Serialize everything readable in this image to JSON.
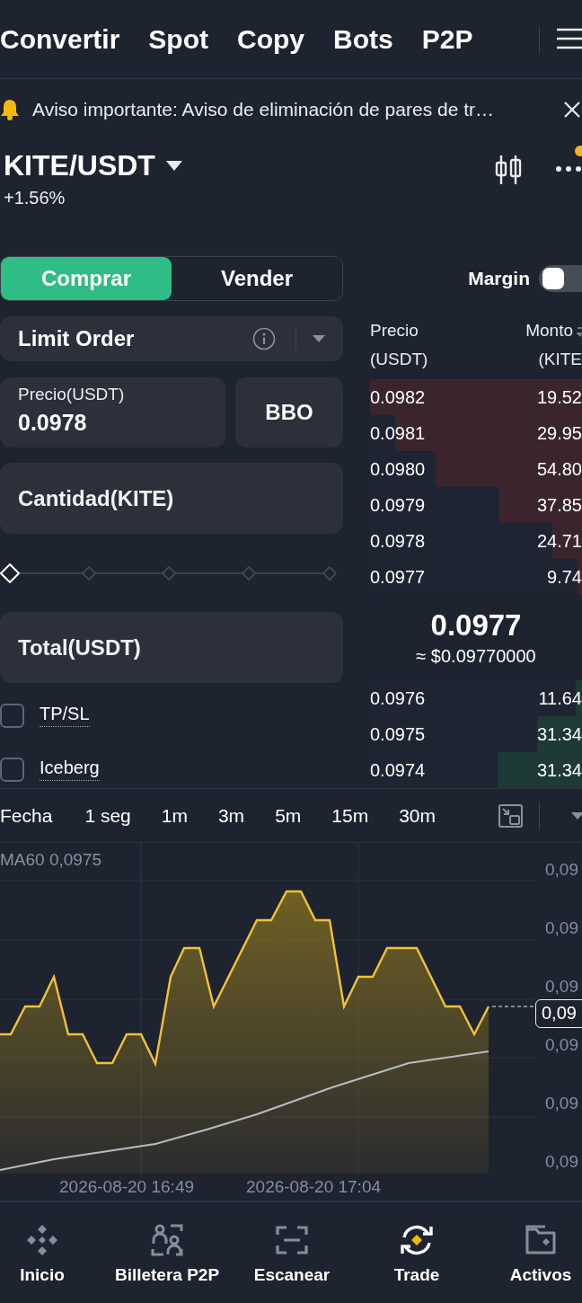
{
  "top_tabs": [
    {
      "label": "Convertir"
    },
    {
      "label": "Spot"
    },
    {
      "label": "Copy"
    },
    {
      "label": "Bots"
    },
    {
      "label": "P2P"
    }
  ],
  "notice": {
    "text": "Aviso importante: Aviso de eliminación de pares de tr…"
  },
  "pair": {
    "symbol": "KITE/USDT",
    "change": "+1.56%"
  },
  "order_form": {
    "sides": [
      {
        "label": "Comprar",
        "selected": true
      },
      {
        "label": "Vender",
        "selected": false
      }
    ],
    "margin": {
      "label": "Margin",
      "on": false
    },
    "order_type": "Limit Order",
    "price": {
      "label": "Precio(USDT)",
      "value": "0.0978"
    },
    "bbo": "BBO",
    "quantity": {
      "placeholder": "Cantidad(KITE)"
    },
    "slider": {
      "level": 0
    },
    "total": {
      "placeholder": "Total(USDT)"
    },
    "options": [
      {
        "label": "TP/SL",
        "checked": false
      },
      {
        "label": "Iceberg",
        "checked": false
      }
    ]
  },
  "order_book": {
    "price_header": "Precio (USDT)",
    "amount_header": "Monto",
    "amount_unit": "(KITE",
    "asks": [
      {
        "price": "0.0982",
        "amount": "19.52",
        "level": 1.0
      },
      {
        "price": "0.0981",
        "amount": "29.95",
        "level": 0.88
      },
      {
        "price": "0.0980",
        "amount": "54.80",
        "level": 0.69
      },
      {
        "price": "0.0979",
        "amount": "37.85",
        "level": 0.39
      },
      {
        "price": "0.0978",
        "amount": "24.71",
        "level": 0.14
      },
      {
        "price": "0.0977",
        "amount": "9.74",
        "level": 0.02
      }
    ],
    "mid_price": "0.0977",
    "mid_usd": "≈ $0.09770000",
    "bids": [
      {
        "price": "0.0976",
        "amount": "11.64",
        "level": 0.03
      },
      {
        "price": "0.0975",
        "amount": "31.34",
        "level": 0.21
      },
      {
        "price": "0.0974",
        "amount": "31.34",
        "level": 0.4
      }
    ]
  },
  "chart": {
    "intervals": [
      {
        "label": "Fecha"
      },
      {
        "label": "1 seg"
      },
      {
        "label": "1m"
      },
      {
        "label": "3m"
      },
      {
        "label": "5m"
      },
      {
        "label": "15m"
      },
      {
        "label": "30m"
      }
    ],
    "ma_label": "MA60 0,0975",
    "y_labels": [
      "0,09",
      "0,09",
      "0,09",
      "0,09",
      "0,09",
      "0,09"
    ],
    "price_tag": "0,09",
    "x_labels": [
      "2026-08-20 16:49",
      "2026-08-20 17:04"
    ]
  },
  "bottom_nav": [
    {
      "label": "Inicio",
      "kind": "home",
      "selected": false
    },
    {
      "label": "Billetera P2P",
      "kind": "p2p",
      "selected": false
    },
    {
      "label": "Escanear",
      "kind": "scan",
      "selected": false
    },
    {
      "label": "Trade",
      "kind": "trade",
      "selected": true
    },
    {
      "label": "Activos",
      "kind": "assets",
      "selected": false
    }
  ]
}
